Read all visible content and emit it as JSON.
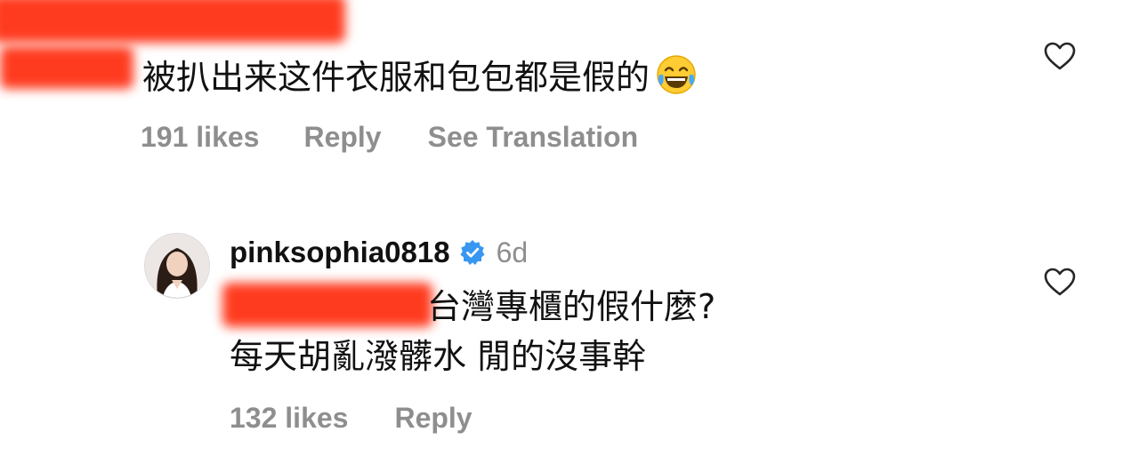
{
  "comment1": {
    "text": "被扒出来这件衣服和包包都是假的",
    "emoji": "face-with-tears-of-joy",
    "likes": "191 likes",
    "reply_label": "Reply",
    "translation_label": "See Translation"
  },
  "comment2": {
    "username": "pinksophia0818",
    "time": "6d",
    "line1": "台灣專櫃的假什麼?",
    "line2": "每天胡亂潑髒水 閒的沒事幹",
    "likes": "132 likes",
    "reply_label": "Reply"
  },
  "colors": {
    "redaction": "#ff3b1f",
    "meta_gray": "#8e8e8e",
    "verified_blue": "#3897f0"
  }
}
